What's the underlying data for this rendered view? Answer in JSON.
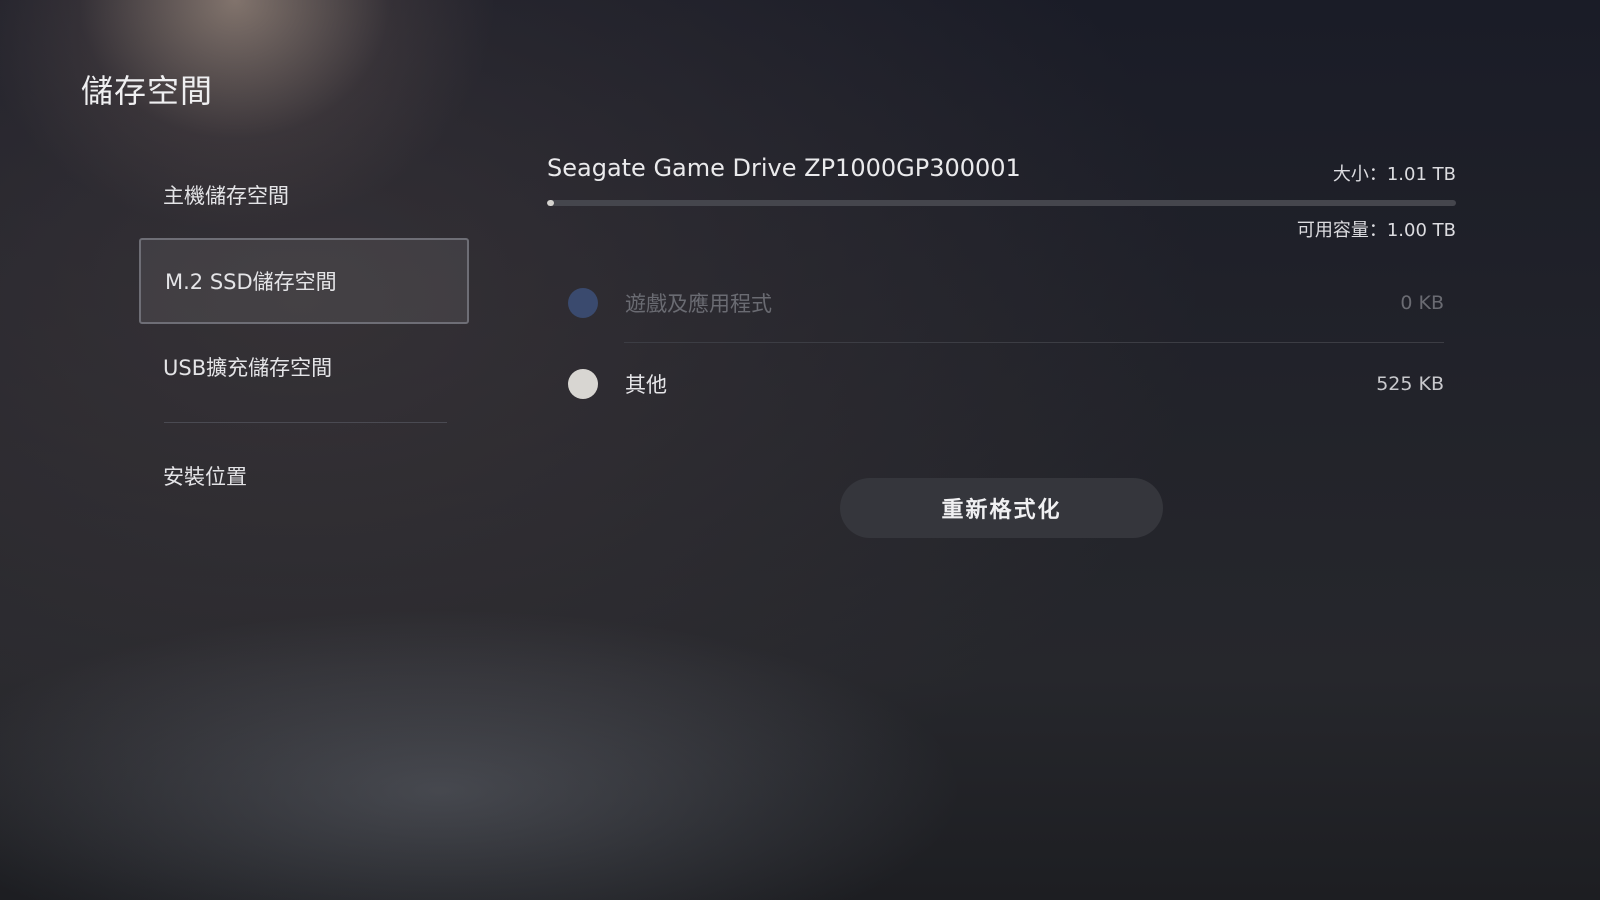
{
  "page": {
    "title": "儲存空間"
  },
  "sidebar": {
    "items": [
      {
        "label": "主機儲存空間",
        "selected": false
      },
      {
        "label": "M.2 SSD儲存空間",
        "selected": true
      },
      {
        "label": "USB擴充儲存空間",
        "selected": false
      },
      {
        "label": "安裝位置",
        "selected": false
      }
    ]
  },
  "drive": {
    "name": "Seagate Game Drive ZP1000GP300001",
    "size_text": "大小：1.01 TB",
    "free_text": "可用容量：1.00 TB",
    "used_fraction": 0.008,
    "bar_color": "#d5d3cf"
  },
  "categories": [
    {
      "label": "遊戲及應用程式",
      "value": "0 KB",
      "color": "#3a4a6e",
      "dimmed": true
    },
    {
      "label": "其他",
      "value": "525 KB",
      "color": "#d8d6d2",
      "dimmed": false
    }
  ],
  "actions": {
    "reformat_label": "重新格式化"
  },
  "colors": {
    "background": "#1e2028",
    "selected_border": "#6e6e76"
  }
}
